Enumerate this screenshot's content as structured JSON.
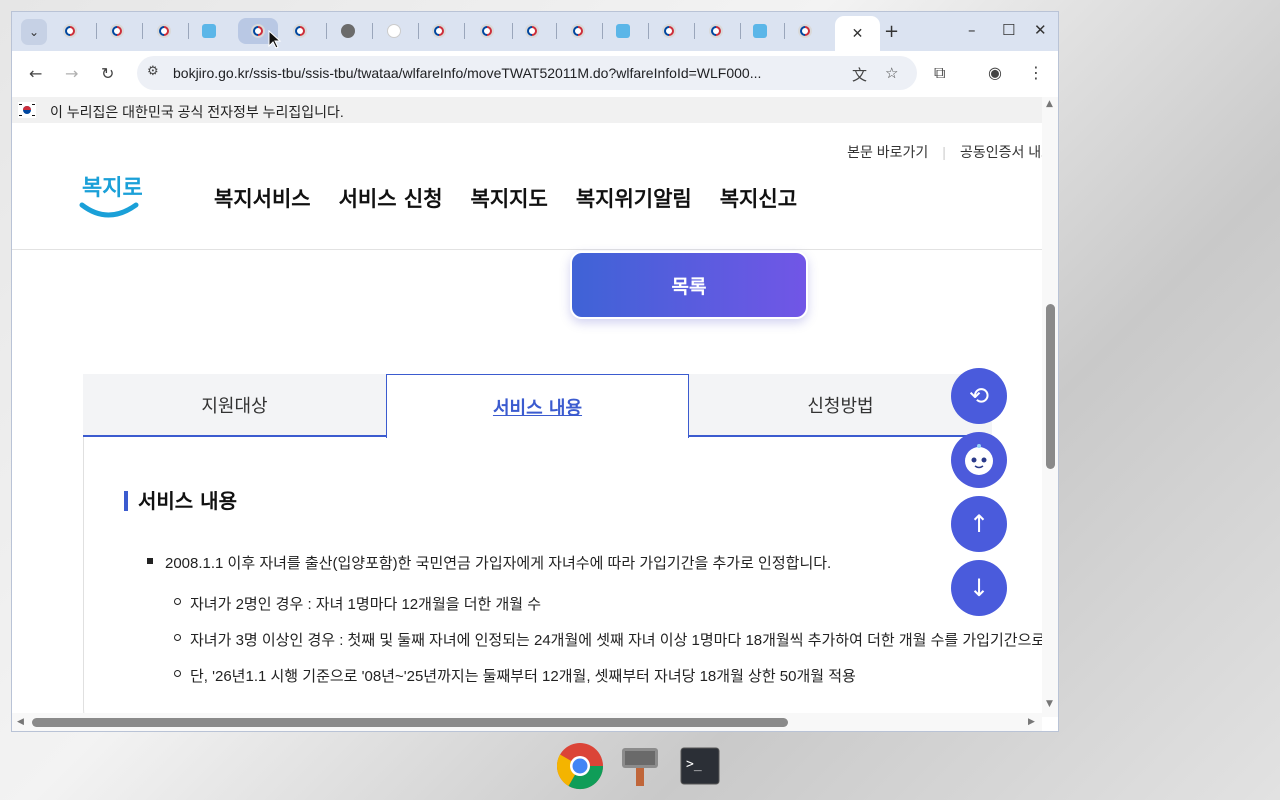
{
  "browser": {
    "active_tab_close": "✕",
    "new_tab": "+",
    "url": "bokjiro.go.kr/ssis-tbu/ssis-tbu/twataa/wlfareInfo/moveTWAT52011M.do?wlfareInfoId=WLF000...",
    "controls": {
      "minimize": "–",
      "maximize": "☐",
      "close": "✕"
    }
  },
  "page": {
    "gov_banner": "이 누리집은 대한민국 공식 전자정부 누리집입니다.",
    "util_links": [
      "본문 바로가기",
      "공동인증서 내보"
    ],
    "logo_text": "복지로",
    "nav": [
      "복지서비스",
      "서비스 신청",
      "복지지도",
      "복지위기알림",
      "복지신고"
    ],
    "list_button": "목록",
    "tabs": [
      "지원대상",
      "서비스 내용",
      "신청방법"
    ],
    "section_title": "서비스 내용",
    "bullets": {
      "main": "2008.1.1 이후 자녀를 출산(입양포함)한 국민연금 가입자에게 자녀수에 따라 가입기간을 추가로 인정합니다.",
      "sub": [
        "자녀가 2명인 경우 : 자녀 1명마다 12개월을 더한 개월 수",
        "자녀가 3명 이상인 경우 : 첫째 및 둘째 자녀에 인정되는 24개월에 셋째 자녀 이상 1명마다 18개월씩 추가하여 더한 개월 수를 가입기간으로",
        "단, '26년1.1 시행 기준으로 '08년~'25년까지는 둘째부터 12개월, 셋째부터 자녀당 18개월 상한 50개월 적용"
      ]
    }
  },
  "colors": {
    "accent": "#3b5bcf",
    "fab": "#4a5bdc",
    "button_gradient_start": "#3f63d6",
    "button_gradient_end": "#7156e6"
  }
}
